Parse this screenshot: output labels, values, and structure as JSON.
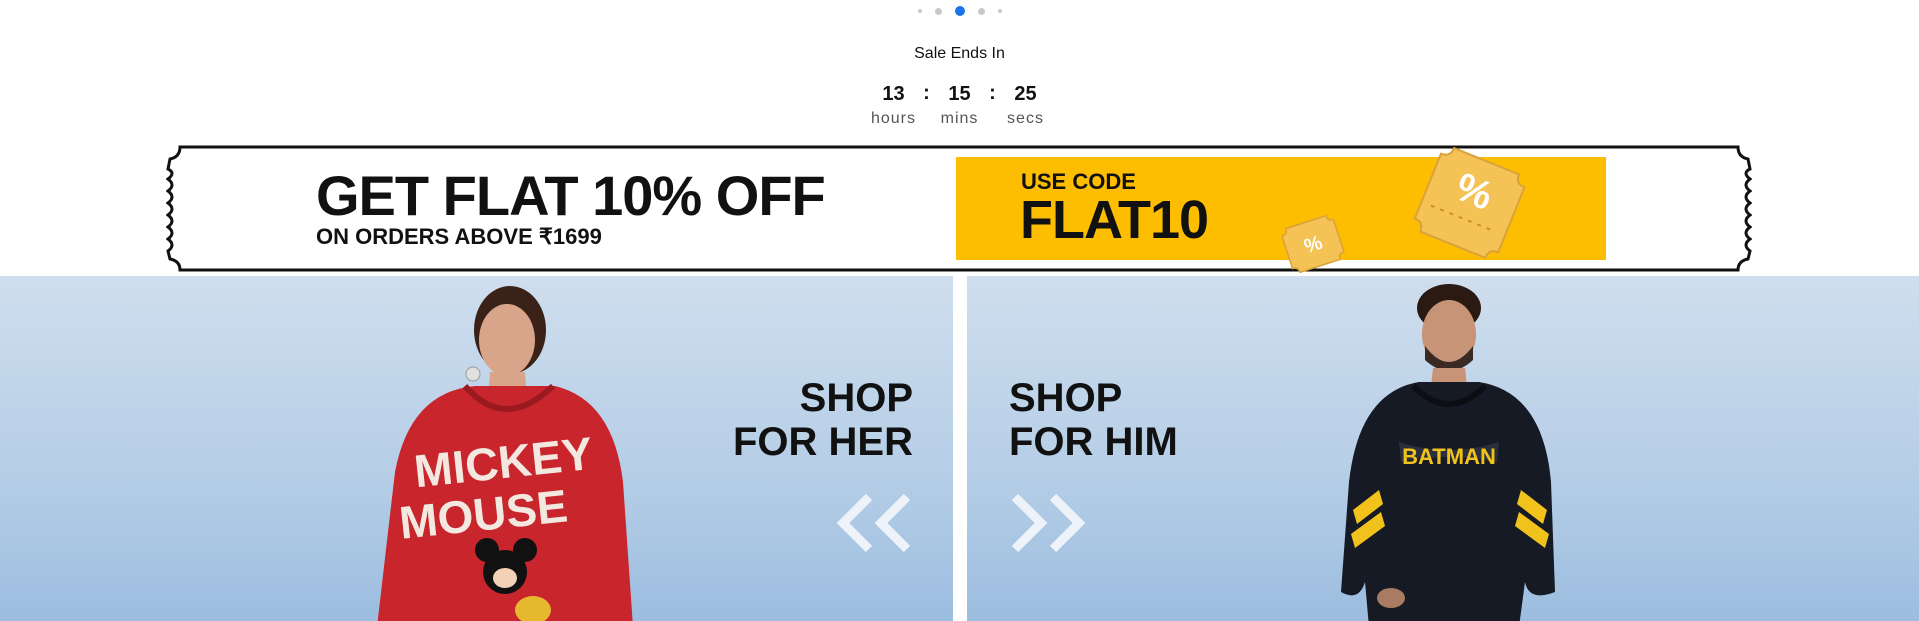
{
  "carousel": {
    "dots": [
      {
        "size": "sm",
        "active": false
      },
      {
        "size": "md",
        "active": false
      },
      {
        "size": "active",
        "active": true
      },
      {
        "size": "md",
        "active": false
      },
      {
        "size": "sm",
        "active": false
      }
    ]
  },
  "sale": {
    "title": "Sale Ends In",
    "hours": "13",
    "hours_label": "hours",
    "mins": "15",
    "mins_label": "mins",
    "secs": "25",
    "secs_label": "secs",
    "separator": ":"
  },
  "promo": {
    "headline": "GET FLAT 10% OFF",
    "subline": "ON ORDERS ABOVE ₹1699",
    "code_label": "USE CODE",
    "code_value": "FLAT10",
    "coupon_symbol": "%"
  },
  "shop_her": {
    "line1": "SHOP",
    "line2": "FOR HER",
    "arrow_icon": "chevrons-left-icon",
    "hoodie_text_1": "MICKEY",
    "hoodie_text_2": "MOUSE"
  },
  "shop_him": {
    "line1": "SHOP",
    "line2": "FOR HIM",
    "arrow_icon": "chevrons-right-icon",
    "hoodie_text": "BATMAN"
  },
  "colors": {
    "accent_blue": "#1a73e8",
    "promo_yellow": "#fdbd00",
    "panel_blue": "#b4cde6"
  }
}
